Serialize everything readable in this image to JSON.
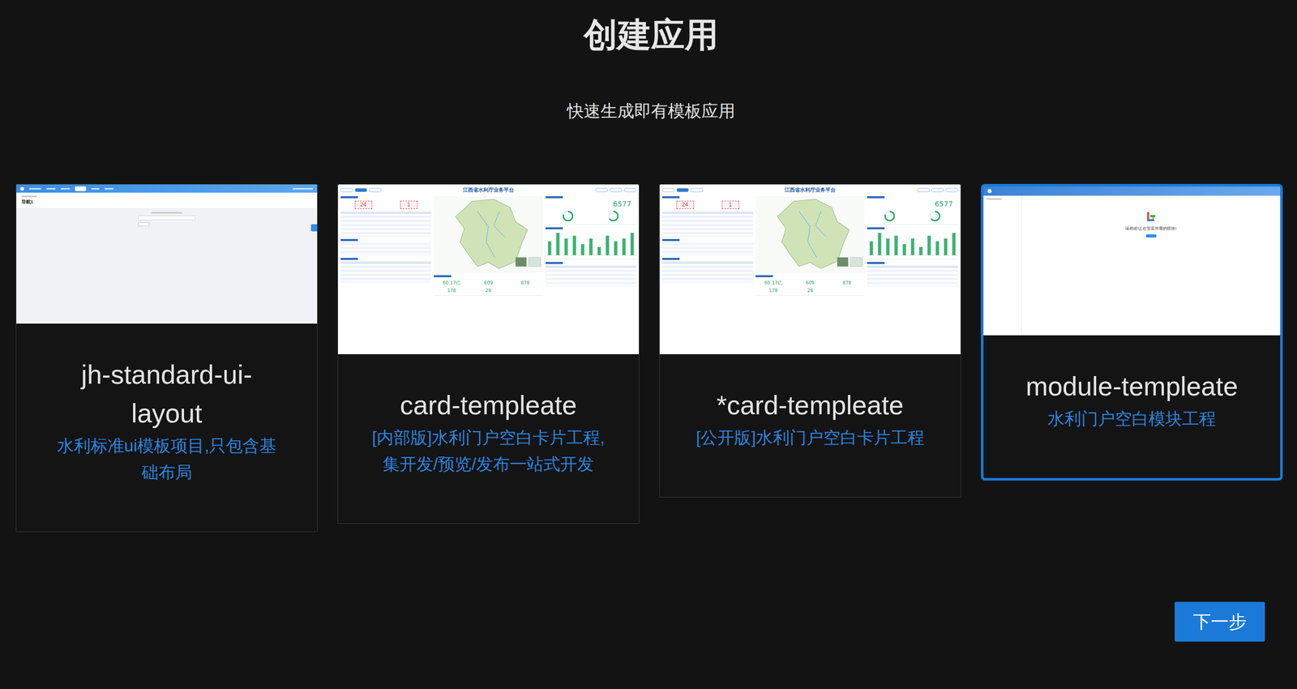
{
  "page": {
    "title": "创建应用",
    "subtitle": "快速生成即有模板应用"
  },
  "templates": [
    {
      "name": "jh-standard-ui-layout",
      "description": "水利标准ui模板项目,只包含基础布局",
      "selected": false,
      "kind": "layout",
      "preview": {
        "heading": "导航1"
      }
    },
    {
      "name": "card-templeate",
      "description": "[内部版]水利门户空白卡片工程,集开发/预览/发布一站式开发",
      "selected": false,
      "kind": "dashboard",
      "preview": {
        "title": "江西省水利厅业务平台",
        "alerts": [
          "24",
          "1"
        ],
        "total": "6577",
        "rings": [
          0.8,
          0.65
        ],
        "bars": [
          5,
          8,
          6,
          7,
          4,
          6,
          3,
          7,
          5,
          6,
          8
        ],
        "stats": [
          "60.17亿",
          "609",
          "878",
          "178",
          "28"
        ]
      }
    },
    {
      "name": "*card-templeate",
      "description": "[公开版]水利门户空白卡片工程",
      "selected": false,
      "kind": "dashboard",
      "preview": {
        "title": "江西省水利厅业务平台",
        "alerts": [
          "24",
          "1"
        ],
        "total": "6577",
        "rings": [
          0.8,
          0.65
        ],
        "bars": [
          5,
          8,
          6,
          7,
          4,
          6,
          3,
          7,
          5,
          6,
          8
        ],
        "stats": [
          "60.17亿",
          "609",
          "878",
          "178",
          "28"
        ]
      }
    },
    {
      "name": "module-templeate",
      "description": "水利门户空白模块工程",
      "selected": true,
      "kind": "module",
      "preview": {
        "message": "请稍候!正在安装所需的模块!"
      }
    }
  ],
  "next_button": "下一步"
}
